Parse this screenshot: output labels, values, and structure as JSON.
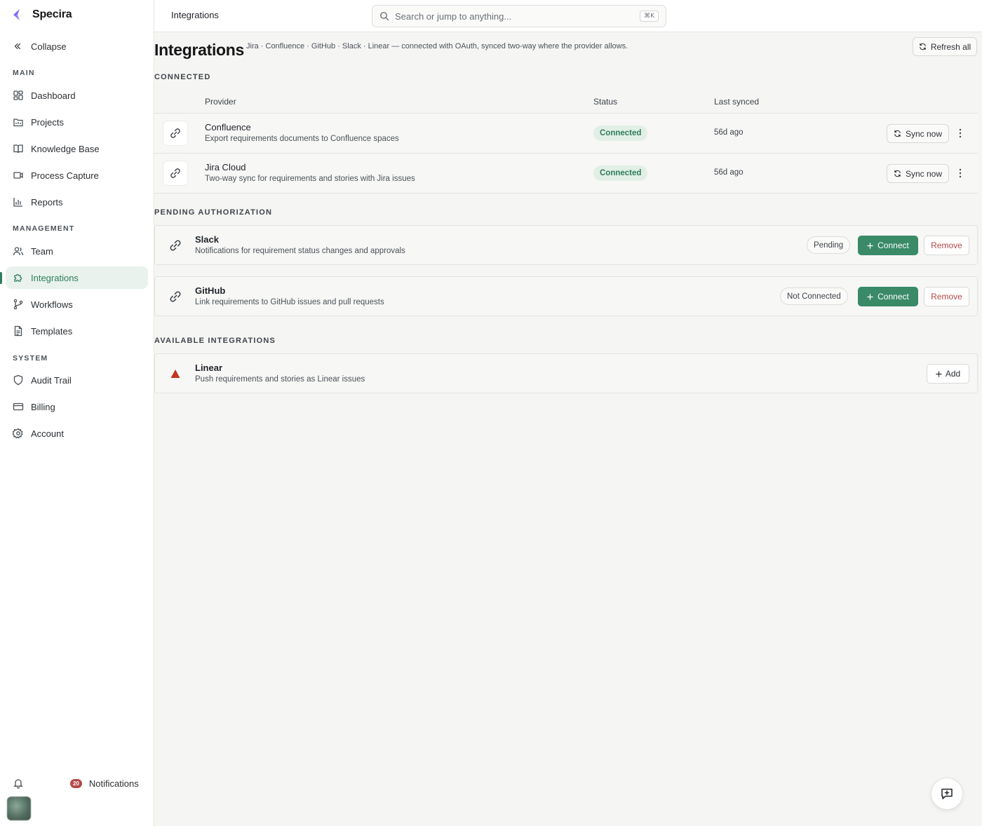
{
  "app": {
    "name": "Specira"
  },
  "sidebar": {
    "collapse_label": "Collapse",
    "sections": {
      "main": "MAIN",
      "management": "MANAGEMENT",
      "system": "SYSTEM"
    },
    "items": [
      {
        "label": "Dashboard",
        "icon": "dashboard-icon"
      },
      {
        "label": "Projects",
        "icon": "folder-icon"
      },
      {
        "label": "Knowledge Base",
        "icon": "book-icon"
      },
      {
        "label": "Process Capture",
        "icon": "video-icon"
      },
      {
        "label": "Reports",
        "icon": "bar-chart-icon"
      },
      {
        "label": "Team",
        "icon": "users-icon"
      },
      {
        "label": "Integrations",
        "icon": "puzzle-icon",
        "active": true
      },
      {
        "label": "Workflows",
        "icon": "git-branch-icon"
      },
      {
        "label": "Templates",
        "icon": "file-text-icon"
      },
      {
        "label": "Audit Trail",
        "icon": "shield-icon"
      },
      {
        "label": "Billing",
        "icon": "credit-card-icon"
      },
      {
        "label": "Account",
        "icon": "gear-icon"
      }
    ],
    "notifications": {
      "label": "Notifications",
      "count": "20"
    }
  },
  "topbar": {
    "breadcrumb": "Integrations",
    "search_placeholder": "Search or jump to anything...",
    "search_shortcut": "⌘K"
  },
  "page": {
    "title": "Integrations",
    "subtitle": "Jira · Confluence · GitHub · Slack · Linear — connected with OAuth, synced two-way where the provider allows.",
    "refresh_all_label": "Refresh all"
  },
  "connected": {
    "section_label": "CONNECTED",
    "columns": {
      "provider": "Provider",
      "status": "Status",
      "last_synced": "Last synced"
    },
    "rows": [
      {
        "name": "Confluence",
        "description": "Export requirements documents to Confluence spaces",
        "status": "Connected",
        "last_synced": "56d ago",
        "sync_label": "Sync now"
      },
      {
        "name": "Jira Cloud",
        "description": "Two-way sync for requirements and stories with Jira issues",
        "status": "Connected",
        "last_synced": "56d ago",
        "sync_label": "Sync now"
      }
    ]
  },
  "pending": {
    "section_label": "PENDING AUTHORIZATION",
    "items": [
      {
        "name": "Slack",
        "description": "Notifications for requirement status changes and approvals",
        "status": "Pending",
        "connect_label": "Connect",
        "remove_label": "Remove"
      },
      {
        "name": "GitHub",
        "description": "Link requirements to GitHub issues and pull requests",
        "status": "Not Connected",
        "connect_label": "Connect",
        "remove_label": "Remove"
      }
    ]
  },
  "available": {
    "section_label": "AVAILABLE INTEGRATIONS",
    "items": [
      {
        "name": "Linear",
        "description": "Push requirements and stories as Linear issues",
        "add_label": "Add"
      }
    ]
  },
  "colors": {
    "accent": "#2e7d5b",
    "connect_button": "#3a8a68",
    "connected_badge_bg": "#e2efe6",
    "danger": "#b54949",
    "linear_icon": "#c2361e",
    "logo": "#7b6cf6"
  }
}
